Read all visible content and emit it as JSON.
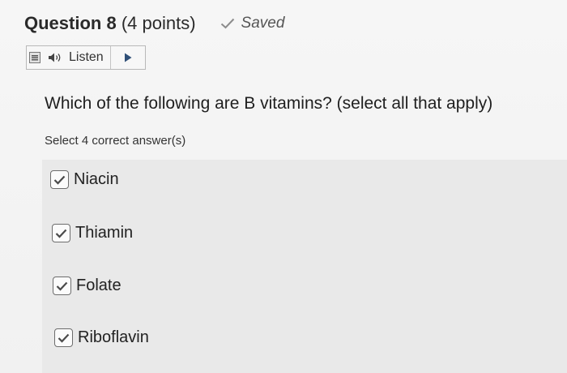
{
  "question": {
    "number_label": "Question 8",
    "points_label": "(4 points)",
    "saved_label": "Saved"
  },
  "listen": {
    "label": "Listen"
  },
  "prompt": "Which of the following are B vitamins? (select all that apply)",
  "instruction": "Select 4 correct answer(s)",
  "answers": [
    {
      "label": "Niacin",
      "checked": true
    },
    {
      "label": "Thiamin",
      "checked": true
    },
    {
      "label": "Folate",
      "checked": true
    },
    {
      "label": "Riboflavin",
      "checked": true
    }
  ],
  "colors": {
    "answer_panel_bg": "#e9e9e9",
    "checkmark": "#4a4a4a",
    "saved_check": "#8c8c8c"
  }
}
